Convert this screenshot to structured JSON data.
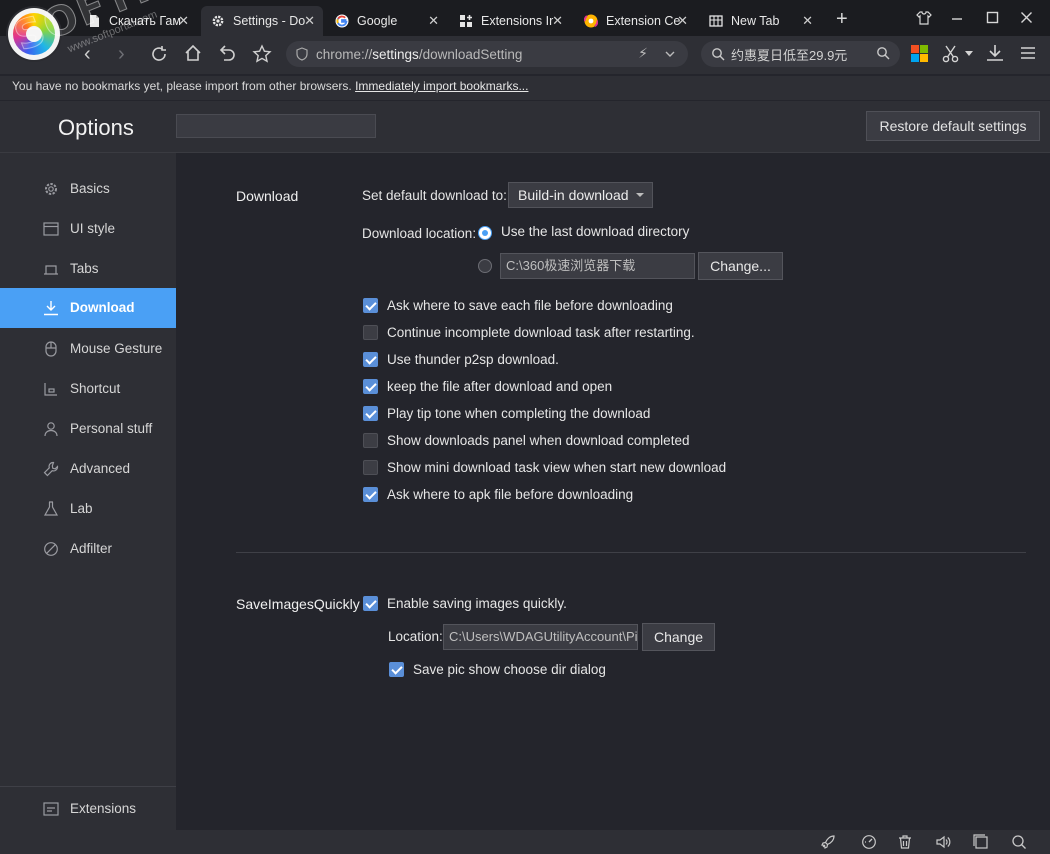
{
  "tabs": [
    {
      "title": "Скачать Гам",
      "favicon": "document-icon",
      "active": false
    },
    {
      "title": "Settings - Do",
      "favicon": "gear-icon",
      "active": true
    },
    {
      "title": "Google",
      "favicon": "google-icon",
      "active": false
    },
    {
      "title": "Extensions Ir",
      "favicon": "extensions-icon",
      "active": false
    },
    {
      "title": "Extension Ce",
      "favicon": "browser-logo-icon",
      "active": false
    },
    {
      "title": "New Tab",
      "favicon": "grid-icon",
      "active": false
    }
  ],
  "toolbar": {
    "url_prefix": "chrome://",
    "url_highlight": "settings",
    "url_suffix": "/downloadSetting",
    "search_query": "约惠夏日低至29.9元"
  },
  "bookmarks_bar": {
    "message": "You have no bookmarks yet, please import from other browsers. ",
    "import_link": "Immediately import bookmarks..."
  },
  "watermark": {
    "text": "SOFTPORTAL",
    "url": "www.softportal.com"
  },
  "options": {
    "title": "Options",
    "search_placeholder": "",
    "restore_button": "Restore default settings"
  },
  "sidebar": {
    "items": [
      {
        "label": "Basics",
        "icon": "gear-icon"
      },
      {
        "label": "UI style",
        "icon": "window-icon"
      },
      {
        "label": "Tabs",
        "icon": "tab-icon"
      },
      {
        "label": "Download",
        "icon": "download-icon",
        "selected": true
      },
      {
        "label": "Mouse Gesture",
        "icon": "mouse-icon"
      },
      {
        "label": "Shortcut",
        "icon": "shortcut-icon"
      },
      {
        "label": "Personal stuff",
        "icon": "person-icon"
      },
      {
        "label": "Advanced",
        "icon": "wrench-icon"
      },
      {
        "label": "Lab",
        "icon": "flask-icon"
      },
      {
        "label": "Adfilter",
        "icon": "block-icon"
      }
    ],
    "extensions": {
      "label": "Extensions",
      "icon": "extensions-icon"
    }
  },
  "download": {
    "section_title": "Download",
    "default_label": "Set default download to:",
    "default_value": "Build-in download",
    "location_label": "Download location:",
    "radio_last_dir": "Use the last download directory",
    "path_value": "C:\\360极速浏览器下载",
    "change_button": "Change...",
    "options": [
      {
        "label": "Ask where to save each file before downloading",
        "checked": true
      },
      {
        "label": "Continue incomplete download task after restarting.",
        "checked": false
      },
      {
        "label": "Use thunder p2sp download.",
        "checked": true
      },
      {
        "label": "keep the file after download and open",
        "checked": true
      },
      {
        "label": "Play tip tone when completing the download",
        "checked": true
      },
      {
        "label": "Show downloads panel when download completed",
        "checked": false
      },
      {
        "label": "Show mini download task view when start new download",
        "checked": false
      },
      {
        "label": "Ask where to apk file before downloading",
        "checked": true
      }
    ]
  },
  "save_images": {
    "section_title": "SaveImagesQuickly",
    "enable_label": "Enable saving images quickly.",
    "enable_checked": true,
    "location_label": "Location:",
    "location_value": "C:\\Users\\WDAGUtilityAccount\\Pi",
    "change_button": "Change",
    "dialog_label": "Save pic show choose dir dialog",
    "dialog_checked": true
  },
  "colors": {
    "accent": "#4aa0f5",
    "background": "#24252c",
    "sidebar": "#2e2f35",
    "checkbox": "#5a8fd8"
  }
}
